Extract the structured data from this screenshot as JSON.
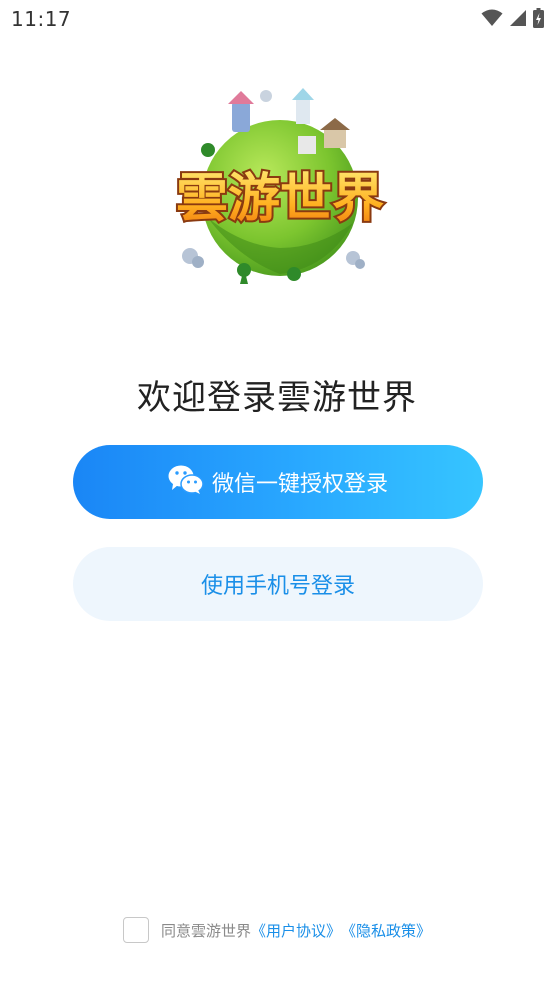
{
  "status_bar": {
    "time": "11:17",
    "icons": [
      "wifi-icon",
      "signal-icon",
      "battery-charging-icon"
    ]
  },
  "logo": {
    "text": "雲游世界"
  },
  "welcome_title": "欢迎登录雲游世界",
  "buttons": {
    "wechat_label": "微信一键授权登录",
    "phone_label": "使用手机号登录"
  },
  "agreement": {
    "prefix": "同意雲游世界",
    "user_agreement": "《用户协议》",
    "privacy_policy": "《隐私政策》",
    "checked": false
  },
  "colors": {
    "primary": "#1a8fe8",
    "wechat_gradient_start": "#1a86f6",
    "wechat_gradient_end": "#36c5ff",
    "phone_button_bg": "#eef6fd"
  }
}
